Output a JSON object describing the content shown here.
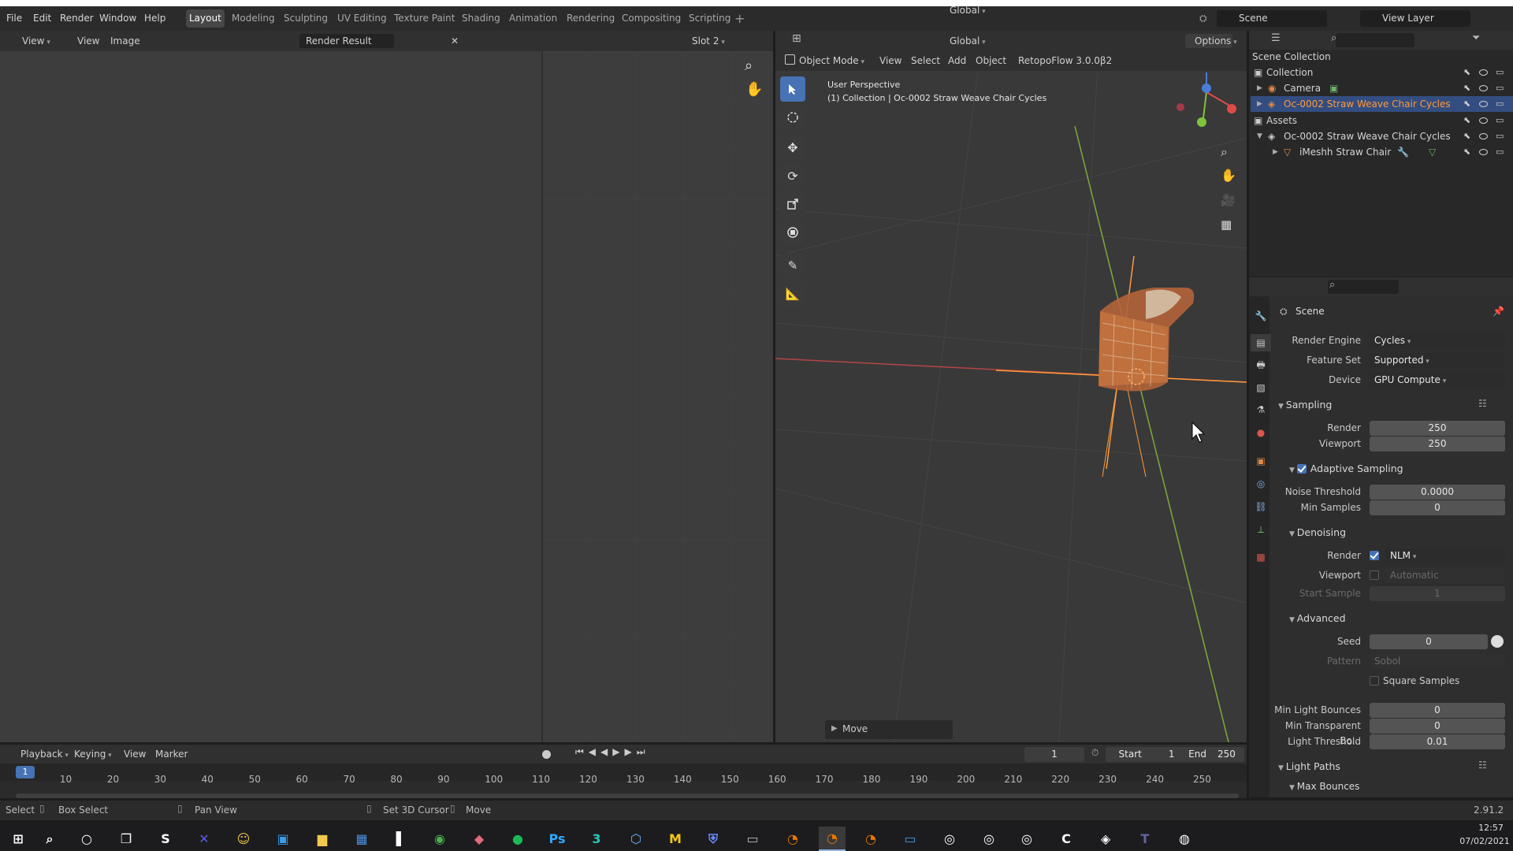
{
  "menu": {
    "file": "File",
    "edit": "Edit",
    "render": "Render",
    "window": "Window",
    "help": "Help"
  },
  "workspaces": [
    "Layout",
    "Modeling",
    "Sculpting",
    "UV Editing",
    "Texture Paint",
    "Shading",
    "Animation",
    "Rendering",
    "Compositing",
    "Scripting"
  ],
  "scene_name": "Scene",
  "view_layer": "View Layer",
  "image_editor": {
    "view": "View",
    "view2": "View",
    "image": "Image",
    "image_name": "Render Result",
    "slot": "Slot 2"
  },
  "viewport": {
    "mode": "Object Mode",
    "view": "View",
    "select": "Select",
    "add": "Add",
    "object": "Object",
    "addon": "RetopoFlow 3.0.0β2",
    "orientation": "Global",
    "options": "Options",
    "perspective": "User Perspective",
    "collection_line": "(1) Collection | Oc-0002 Straw Weave Chair Cycles",
    "operator": "Move"
  },
  "outliner": {
    "scene_collection": "Scene Collection",
    "rows": [
      {
        "label": "Collection"
      },
      {
        "label": "Camera"
      },
      {
        "label": "Oc-0002 Straw Weave Chair Cycles"
      },
      {
        "label": "Assets"
      },
      {
        "label": "Oc-0002 Straw Weave Chair Cycles"
      },
      {
        "label": "iMeshh Straw Chair"
      }
    ]
  },
  "properties": {
    "context": "Scene",
    "render_engine_label": "Render Engine",
    "render_engine": "Cycles",
    "feature_set_label": "Feature Set",
    "feature_set": "Supported",
    "device_label": "Device",
    "device": "GPU Compute",
    "sampling": "Sampling",
    "render_label": "Render",
    "render_samples": "250",
    "viewport_label": "Viewport",
    "viewport_samples": "250",
    "adaptive": "Adaptive Sampling",
    "noise_label": "Noise Threshold",
    "noise": "0.0000",
    "min_samples_label": "Min Samples",
    "min_samples": "0",
    "denoising": "Denoising",
    "dn_render_label": "Render",
    "dn_render": "NLM",
    "dn_viewport_label": "Viewport",
    "dn_viewport": "Automatic",
    "start_sample_label": "Start Sample",
    "start_sample": "1",
    "advanced": "Advanced",
    "seed_label": "Seed",
    "seed": "0",
    "pattern_label": "Pattern",
    "pattern": "Sobol",
    "square": "Square Samples",
    "min_light_label": "Min Light Bounces",
    "min_light": "0",
    "min_transp_label": "Min Transparent Bo...",
    "min_transp": "0",
    "light_thresh_label": "Light Threshold",
    "light_thresh": "0.01",
    "light_paths": "Light Paths",
    "max_bounces": "Max Bounces"
  },
  "timeline": {
    "playback": "Playback",
    "keying": "Keying",
    "view": "View",
    "marker": "Marker",
    "current": "1",
    "start_label": "Start",
    "start": "1",
    "end_label": "End",
    "end": "250",
    "current_marker": "1",
    "ticks": [
      "10",
      "20",
      "30",
      "40",
      "50",
      "60",
      "70",
      "80",
      "90",
      "100",
      "110",
      "120",
      "130",
      "140",
      "150",
      "160",
      "170",
      "180",
      "190",
      "200",
      "210",
      "220",
      "230",
      "240",
      "250"
    ]
  },
  "statusbar": {
    "select": "Select",
    "box_select": "Box Select",
    "pan_view": "Pan View",
    "set_cursor": "Set 3D Cursor",
    "move": "Move",
    "version": "2.91.2"
  },
  "taskbar": {
    "time": "12:57",
    "date": "07/02/2021"
  },
  "colors": {
    "accent": "#4772b3",
    "active_row": "#334d80",
    "object_orange": "#e08a4b"
  }
}
